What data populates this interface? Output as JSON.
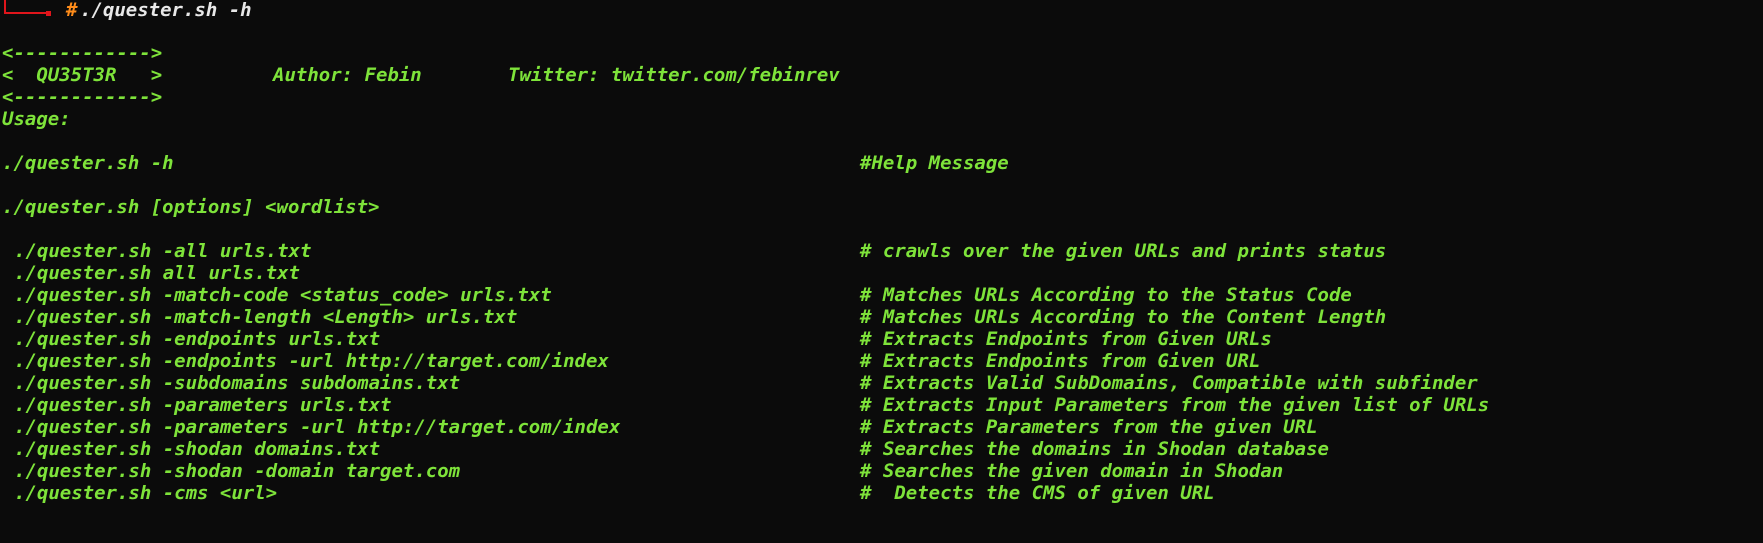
{
  "prompt": {
    "symbol": "#",
    "command": "./quester.sh -h"
  },
  "banner": {
    "top_border": "<------------>",
    "name_line": "<  QU35T3R   >",
    "bottom_border": "<------------>",
    "author": "Author: Febin",
    "twitter": "Twitter: twitter.com/febinrev"
  },
  "usage_label": "Usage:",
  "help": {
    "command": "./quester.sh -h",
    "description": "#Help Message"
  },
  "syntax": "./quester.sh [options] <wordlist>",
  "options": [
    {
      "command": "./quester.sh -all urls.txt",
      "description": "# crawls over the given URLs and prints status"
    },
    {
      "command": "./quester.sh all urls.txt",
      "description": ""
    },
    {
      "command": "./quester.sh -match-code <status_code> urls.txt",
      "description": "# Matches URLs According to the Status Code"
    },
    {
      "command": "./quester.sh -match-length <Length> urls.txt",
      "description": "# Matches URLs According to the Content Length"
    },
    {
      "command": "./quester.sh -endpoints urls.txt",
      "description": "# Extracts Endpoints from Given URLs"
    },
    {
      "command": "./quester.sh -endpoints -url http://target.com/index",
      "description": "# Extracts Endpoints from Given URL"
    },
    {
      "command": "./quester.sh -subdomains subdomains.txt",
      "description": "# Extracts Valid SubDomains, Compatible with subfinder"
    },
    {
      "command": "./quester.sh -parameters urls.txt",
      "description": "# Extracts Input Parameters from the given list of URLs"
    },
    {
      "command": "./quester.sh -parameters -url http://target.com/index",
      "description": "# Extracts Parameters from the given URL"
    },
    {
      "command": "./quester.sh -shodan domains.txt",
      "description": "# Searches the domains in Shodan database"
    },
    {
      "command": "./quester.sh -shodan -domain target.com",
      "description": "# Searches the given domain in Shodan"
    },
    {
      "command": "./quester.sh -cms <url>",
      "description": "#  Detects the CMS of given URL"
    }
  ],
  "colors": {
    "background": "#0b0b0b",
    "text": "#7ee33a",
    "prompt_corner": "#e0151b",
    "prompt_hash": "#ff8c1a",
    "prompt_command": "#e8e8e8"
  }
}
